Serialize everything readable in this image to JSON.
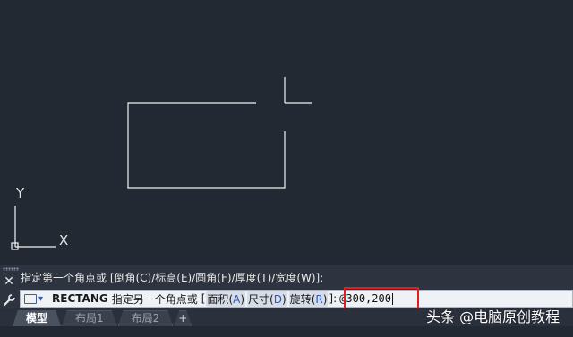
{
  "canvas": {
    "axis_y_label": "Y",
    "axis_x_label": "X",
    "line_color": "#f2f2f2",
    "background": "#222933"
  },
  "command_line": {
    "history": "指定第一个角点或 [倒角(C)/标高(E)/圆角(F)/厚度(T)/宽度(W)]:",
    "command_name": "RECTANG",
    "prompt": "指定另一个角点或",
    "options_open": "[",
    "options": [
      {
        "label": "面积",
        "key": "A"
      },
      {
        "label": "尺寸",
        "key": "D"
      },
      {
        "label": "旋转",
        "key": "R"
      }
    ],
    "options_close": "]:",
    "input_value": "@300,200",
    "close_icon": "close-icon",
    "customize_icon": "wrench-icon"
  },
  "tabs": [
    {
      "label": "模型",
      "active": true
    },
    {
      "label": "布局1",
      "active": false
    },
    {
      "label": "布局2",
      "active": false
    },
    {
      "label": "+",
      "active": false
    }
  ],
  "highlight_color": "#e02020",
  "watermark": "头条 @电脑原创教程"
}
